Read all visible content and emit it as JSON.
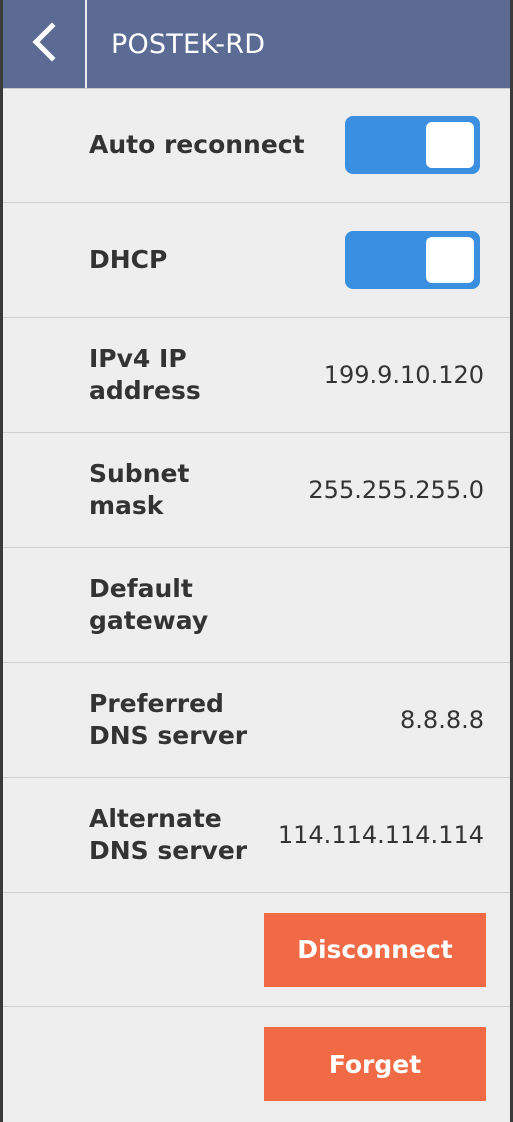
{
  "header": {
    "title": "POSTEK-RD",
    "back_icon": "chevron-left-icon"
  },
  "settings": {
    "auto_reconnect": {
      "label": "Auto reconnect",
      "enabled": true
    },
    "dhcp": {
      "label": "DHCP",
      "enabled": true
    },
    "ipv4": {
      "label": "IPv4 IP\naddress",
      "value": "199.9.10.120"
    },
    "subnet": {
      "label": "Subnet\nmask",
      "value": "255.255.255.0"
    },
    "gateway": {
      "label": "Default\ngateway",
      "value": ""
    },
    "preferred_dns": {
      "label": "Preferred\nDNS server",
      "value": "8.8.8.8"
    },
    "alternate_dns": {
      "label": "Alternate\nDNS server",
      "value": "114.114.114.114"
    }
  },
  "actions": {
    "disconnect_label": "Disconnect",
    "forget_label": "Forget"
  },
  "colors": {
    "header_bg": "#5b6b93",
    "toggle_on": "#3a8fe0",
    "action_button": "#f06a45"
  }
}
